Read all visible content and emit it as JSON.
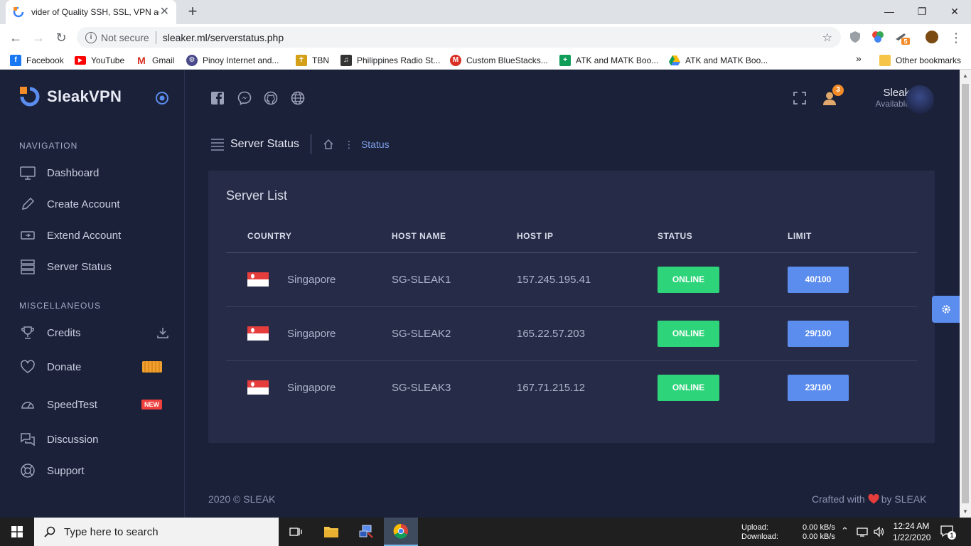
{
  "browser": {
    "tab_title": "vider of Quality SSH, SSL, VPN ac",
    "security_label": "Not secure",
    "url": "sleaker.ml/serverstatus.php",
    "extension_badge": "5",
    "bookmarks": [
      {
        "label": "Facebook",
        "icon": "facebook-icon",
        "color": "#1877f2"
      },
      {
        "label": "YouTube",
        "icon": "youtube-icon",
        "color": "#ff0000"
      },
      {
        "label": "Gmail",
        "icon": "gmail-icon",
        "color": "#d93025"
      },
      {
        "label": "Pinoy Internet and...",
        "icon": "pinoy-icon",
        "color": "#4a4a8a"
      },
      {
        "label": "TBN",
        "icon": "tbn-icon",
        "color": "#d4a017"
      },
      {
        "label": "Philippines Radio St...",
        "icon": "radio-icon",
        "color": "#333333"
      },
      {
        "label": "Custom BlueStacks...",
        "icon": "bluestacks-icon",
        "color": "#d93025"
      },
      {
        "label": "ATK and MATK Boo...",
        "icon": "sheets-icon",
        "color": "#0f9d58"
      },
      {
        "label": "ATK and MATK Boo...",
        "icon": "drive-icon",
        "color": "#fbbc04"
      }
    ],
    "more_bookmarks": "»",
    "other_bookmarks": "Other bookmarks"
  },
  "app": {
    "brand": "SleakVPN",
    "sections": {
      "navigation": "NAVIGATION",
      "misc": "MISCELLANEOUS"
    },
    "nav": [
      {
        "label": "Dashboard",
        "icon": "monitor-icon"
      },
      {
        "label": "Create Account",
        "icon": "pencil-icon"
      },
      {
        "label": "Extend Account",
        "icon": "ticket-icon"
      },
      {
        "label": "Server Status",
        "icon": "server-icon"
      }
    ],
    "misc": [
      {
        "label": "Credits",
        "icon": "trophy-icon"
      },
      {
        "label": "Donate",
        "icon": "heart-icon"
      },
      {
        "label": "SpeedTest",
        "icon": "speedometer-icon",
        "badge": "NEW"
      },
      {
        "label": "Discussion",
        "icon": "chat-icon"
      },
      {
        "label": "Support",
        "icon": "lifebuoy-icon"
      }
    ],
    "user": {
      "name": "Sleak",
      "status": "Available",
      "notifications": "3"
    },
    "breadcrumb": {
      "page_title": "Server Status",
      "current": "Status"
    },
    "card_title": "Server List",
    "columns": [
      "COUNTRY",
      "HOST NAME",
      "HOST IP",
      "STATUS",
      "LIMIT"
    ],
    "servers": [
      {
        "country": "Singapore",
        "host": "SG-SLEAK1",
        "ip": "157.245.195.41",
        "status": "ONLINE",
        "limit": "40/100"
      },
      {
        "country": "Singapore",
        "host": "SG-SLEAK2",
        "ip": "165.22.57.203",
        "status": "ONLINE",
        "limit": "29/100"
      },
      {
        "country": "Singapore",
        "host": "SG-SLEAK3",
        "ip": "167.71.215.12",
        "status": "ONLINE",
        "limit": "23/100"
      }
    ],
    "footer": {
      "copyright": "2020 © SLEAK",
      "crafted_prefix": "Crafted with",
      "crafted_suffix": "by SLEAK"
    },
    "colors": {
      "online": "#2ed47a",
      "limit": "#5b8def",
      "accent": "#7c9ee8",
      "badge": "#f0403e"
    }
  },
  "taskbar": {
    "search_placeholder": "Type here to search",
    "upload_label": "Upload:",
    "download_label": "Download:",
    "upload_value": "0.00 kB/s",
    "download_value": "0.00 kB/s",
    "time": "12:24 AM",
    "date": "1/22/2020",
    "notification_count": "1"
  }
}
